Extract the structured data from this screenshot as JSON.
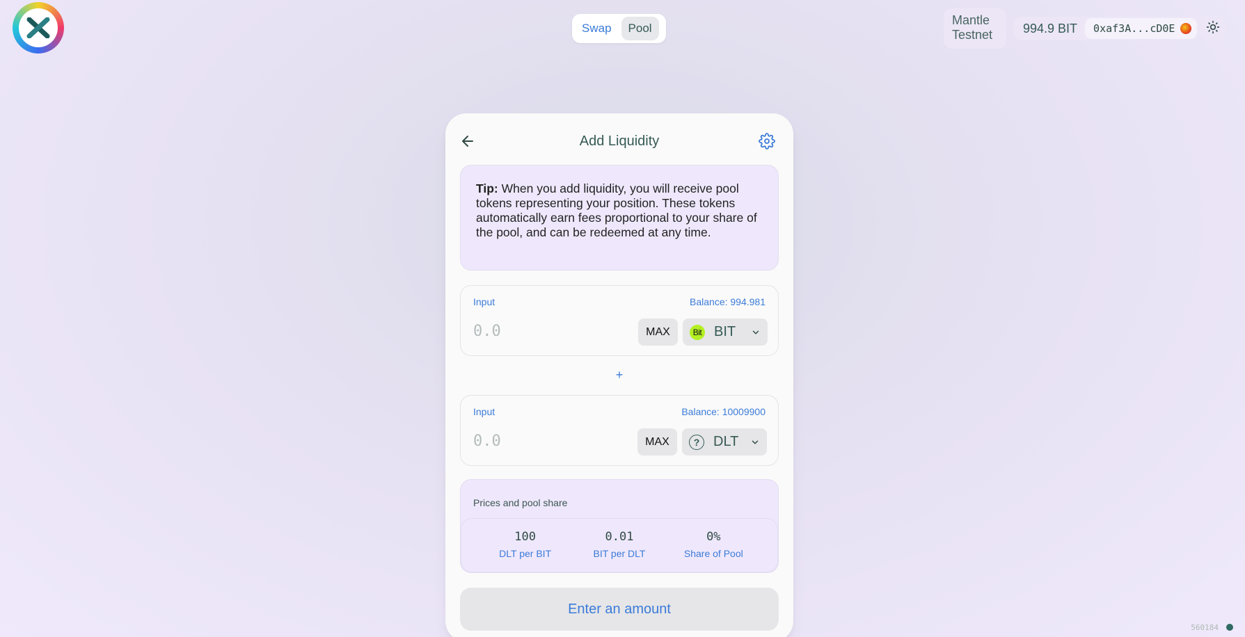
{
  "header": {
    "nav": [
      {
        "label": "Swap",
        "active": false
      },
      {
        "label": "Pool",
        "active": true
      }
    ],
    "network": "Mantle Testnet",
    "balance": "994.9 BIT",
    "address": "0xaf3A...cD0E"
  },
  "card": {
    "title": "Add Liquidity",
    "tip_bold": "Tip:",
    "tip_text": " When you add liquidity, you will receive pool tokens representing your position. These tokens automatically earn fees proportional to your share of the pool, and can be redeemed at any time.",
    "inputs": [
      {
        "label": "Input",
        "balance": "Balance: 994.981",
        "placeholder": "0.0",
        "max_label": "MAX",
        "token_icon_text": "Bit",
        "token": "BIT"
      },
      {
        "label": "Input",
        "balance": "Balance: 10009900",
        "placeholder": "0.0",
        "max_label": "MAX",
        "token_icon_text": "?",
        "token": "DLT"
      }
    ],
    "plus": "+",
    "prices": {
      "title": "Prices and pool share",
      "items": [
        {
          "value": "100",
          "label": "DLT per BIT"
        },
        {
          "value": "0.01",
          "label": "BIT per DLT"
        },
        {
          "value": "0%",
          "label": "Share of Pool"
        }
      ]
    },
    "submit": "Enter an amount"
  },
  "footer": {
    "block_number": "560184"
  },
  "colors": {
    "accent": "#3b7bd8",
    "text": "#365a55",
    "tip_bg": "#efe8fc",
    "bit_token": "#b3f023"
  }
}
